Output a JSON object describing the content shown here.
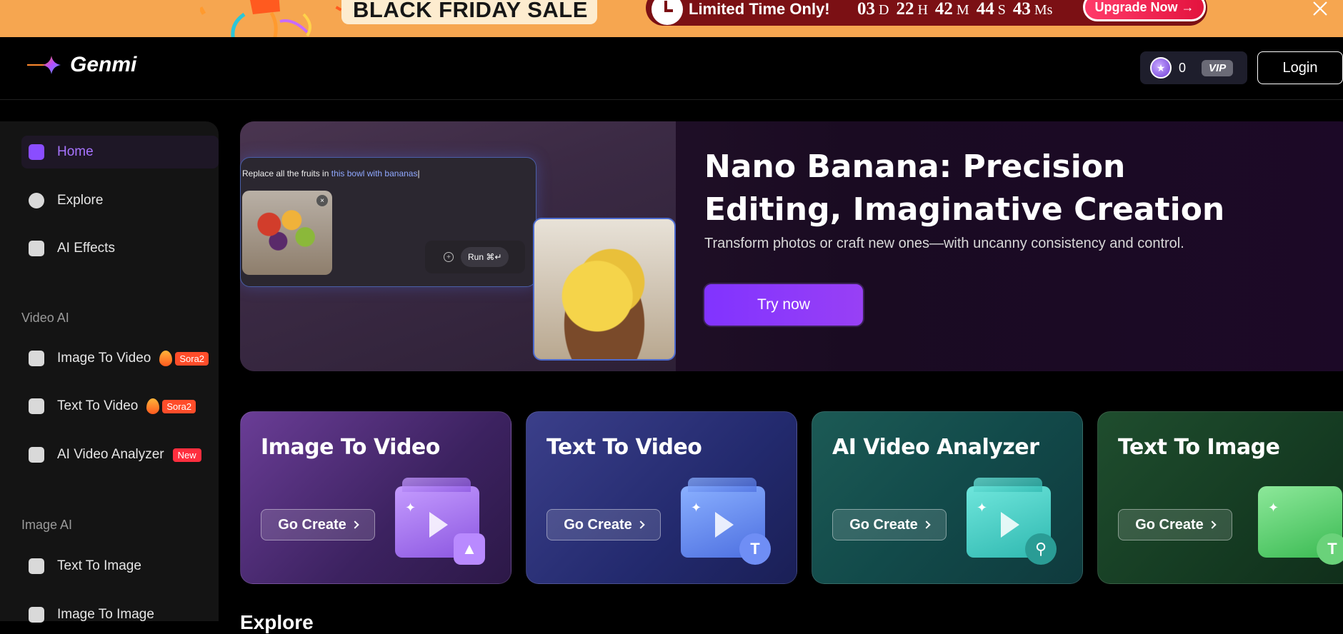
{
  "promo": {
    "sale_text": "BLACK FRIDAY SALE",
    "limited_text": "Limited Time Only!",
    "countdown": [
      {
        "value": "03",
        "unit": "D"
      },
      {
        "value": "22",
        "unit": "H"
      },
      {
        "value": "42",
        "unit": "M"
      },
      {
        "value": "44",
        "unit": "S"
      },
      {
        "value": "43",
        "unit": "Ms"
      }
    ],
    "upgrade_label": "Upgrade Now →"
  },
  "header": {
    "brand": "Genmi",
    "credits": "0",
    "vip_label": "VIP",
    "login_label": "Login"
  },
  "sidebar": {
    "main_items": [
      {
        "label": "Home",
        "icon": "home-icon"
      },
      {
        "label": "Explore",
        "icon": "compass-icon"
      },
      {
        "label": "AI Effects",
        "icon": "effects-icon"
      }
    ],
    "video_heading": "Video AI",
    "video_items": [
      {
        "label": "Image To Video",
        "badge": "Sora2"
      },
      {
        "label": "Text To Video",
        "badge": "Sora2"
      },
      {
        "label": "AI Video Analyzer",
        "badge": "New"
      }
    ],
    "image_heading": "Image AI",
    "image_items": [
      {
        "label": "Text To Image"
      },
      {
        "label": "Image To Image"
      }
    ]
  },
  "hero": {
    "prompt_text": "Replace all the fruits in ",
    "prompt_highlight": "this bowl with bananas",
    "run_label": "Run ⌘↵",
    "plus_icon": "+",
    "remove_icon": "×",
    "title": "Nano Banana: Precision Editing, Imaginative Creation",
    "subtitle": "Transform photos or craft new ones—with uncanny consistency and control.",
    "cta_label": "Try now"
  },
  "cards": [
    {
      "title": "Image To Video",
      "button": "Go Create"
    },
    {
      "title": "Text To Video",
      "button": "Go Create"
    },
    {
      "title": "AI Video Analyzer",
      "button": "Go Create"
    },
    {
      "title": "Text To Image",
      "button": "Go Create"
    }
  ],
  "card_icons": {
    "t": "T"
  },
  "section_label": "Explore",
  "colors": {
    "promo_bg": "#f6a650",
    "accent": "#8133ff",
    "active_text": "#a774ff"
  }
}
